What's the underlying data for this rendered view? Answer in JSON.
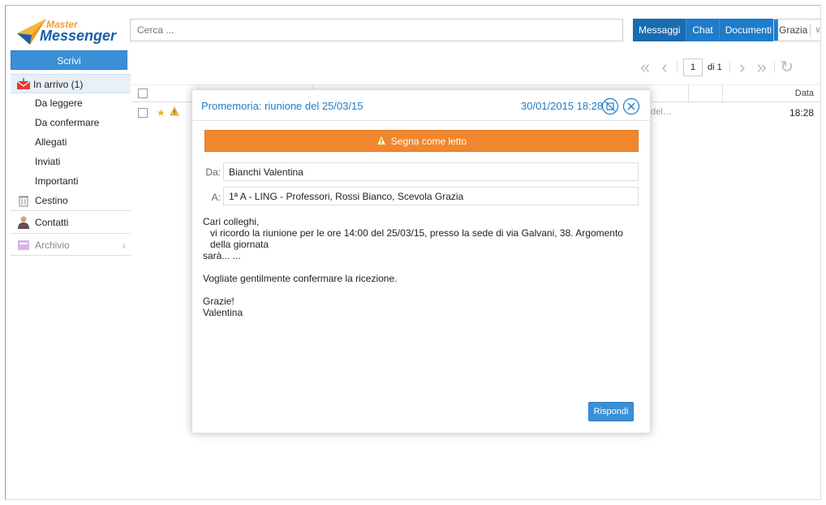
{
  "app": {
    "logo_top": "Master",
    "logo_bottom": "Messenger"
  },
  "search": {
    "placeholder": "Cerca ..."
  },
  "topnav": [
    "Messaggi",
    "Chat",
    "Documenti"
  ],
  "user": {
    "name": "Grazia",
    "chevron": "∨"
  },
  "compose_label": "Scrivi",
  "sidebar": [
    {
      "label": "In arrivo (1)",
      "icon": "inbox-icon"
    },
    {
      "label": "Da leggere"
    },
    {
      "label": "Da confermare"
    },
    {
      "label": "Allegati"
    },
    {
      "label": "Inviati"
    },
    {
      "label": "Importanti"
    },
    {
      "label": "Cestino",
      "icon": "trash-icon"
    },
    {
      "label": "Contatti",
      "icon": "contacts-icon"
    },
    {
      "label": "Archivio",
      "icon": "archive-icon"
    }
  ],
  "pager": {
    "page": "1",
    "of": "di 1"
  },
  "list": {
    "col_data": "Data",
    "rows": [
      {
        "snippet": "del…",
        "time": "18:28"
      }
    ]
  },
  "message": {
    "subject": "Promemoria: riunione del 25/03/15",
    "datetime": "30/01/2015 18:28",
    "mark_read": "Segna come letto",
    "from_label": "Da:",
    "from": "Bianchi Valentina",
    "to_label": "A:",
    "to": "1ª A - LING - Professori, Rossi Bianco, Scevola Grazia",
    "body": {
      "greeting": "Cari colleghi,",
      "line1": "vi ricordo la riunione per le ore 14:00 del 25/03/15, presso la sede di via Galvani, 38. Argomento della giornata",
      "line2": "sarà... ...",
      "para2": "Vogliate gentilmente confermare la ricezione.",
      "closing1": "Grazie!",
      "closing2": "Valentina"
    },
    "reply_label": "Rispondi"
  },
  "colors": {
    "accent": "#1f7cc9",
    "orange": "#f0872f"
  }
}
